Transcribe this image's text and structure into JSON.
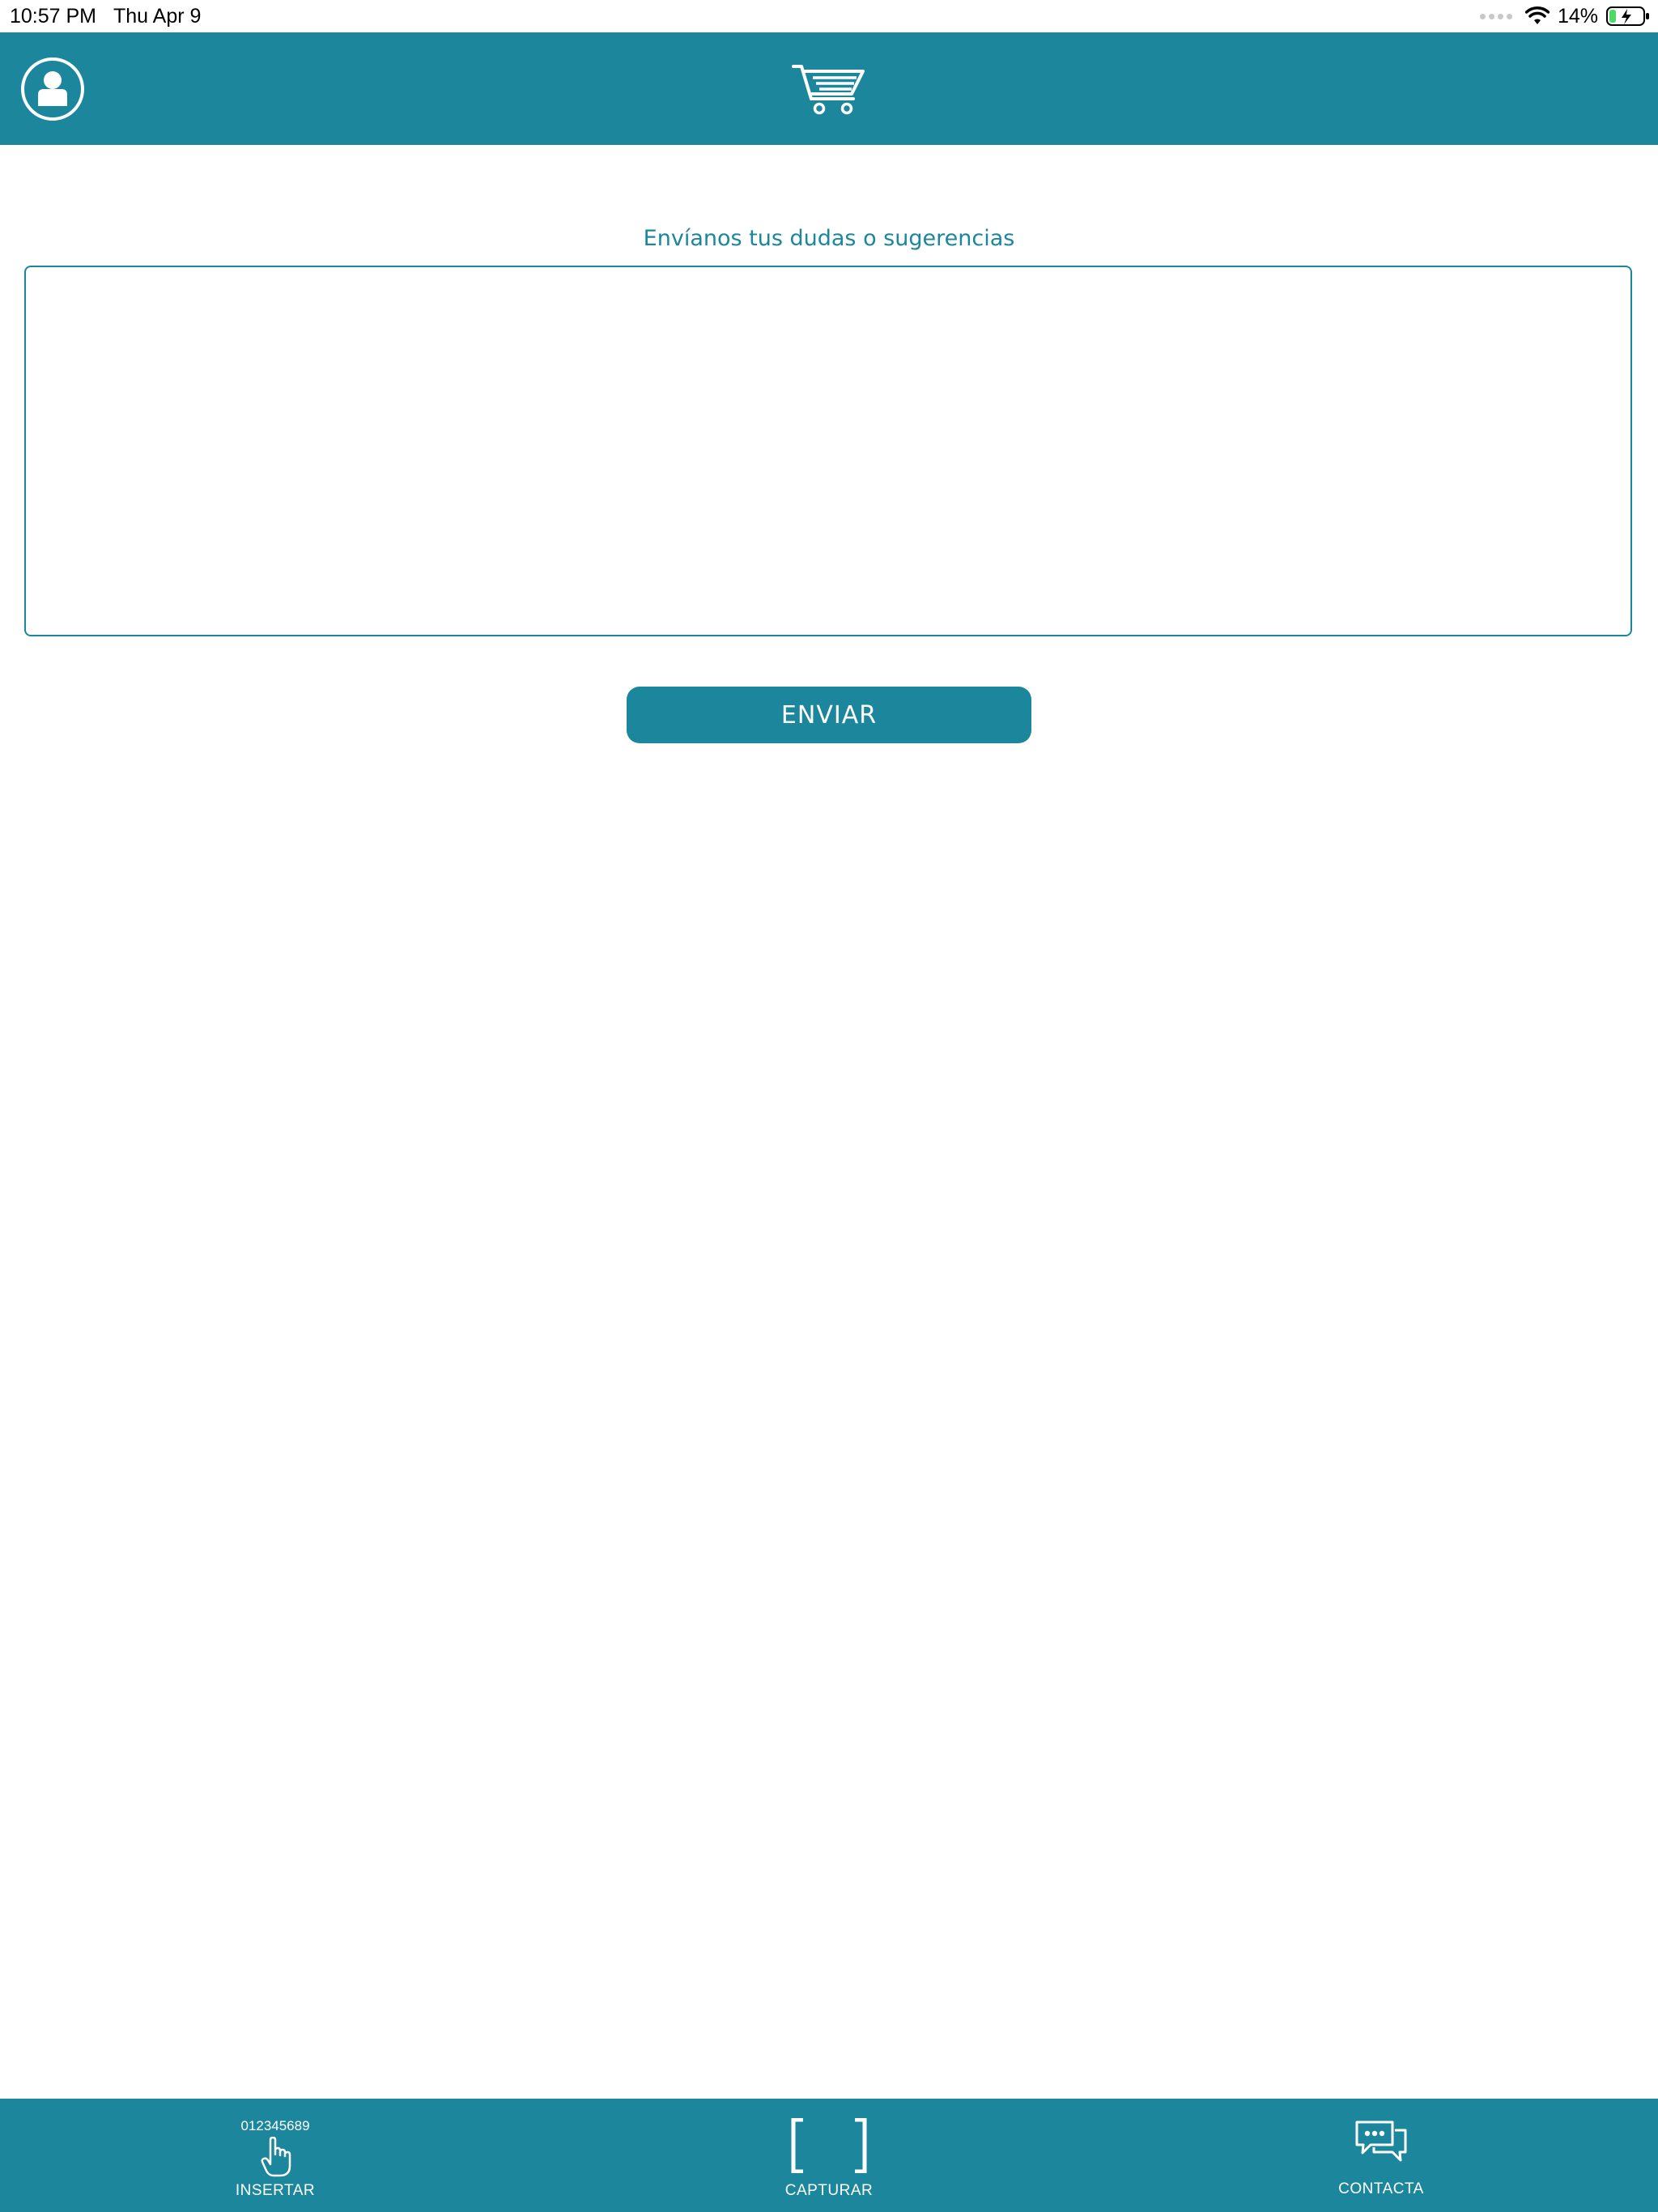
{
  "status_bar": {
    "time": "10:57 PM",
    "date": "Thu Apr 9",
    "battery_percent": "14%",
    "icons": [
      "signal-dots-icon",
      "wifi-icon",
      "battery-charging-icon"
    ]
  },
  "header": {
    "icons": [
      "user-profile-icon",
      "shopping-cart-icon"
    ]
  },
  "main": {
    "prompt": "Envíanos tus dudas o sugerencias",
    "message_value": "",
    "send_label": "ENVIAR"
  },
  "tab_bar": {
    "insert": {
      "code": "012345689",
      "label": "INSERTAR",
      "icon": "pointing-hand-icon"
    },
    "capture": {
      "label": "CAPTURAR",
      "icon": "scan-brackets-icon"
    },
    "contact": {
      "label": "CONTACTA",
      "icon": "chat-bubbles-icon"
    }
  },
  "colors": {
    "brand": "#1c879c",
    "background": "#ffffff",
    "on_brand": "#ffffff"
  }
}
